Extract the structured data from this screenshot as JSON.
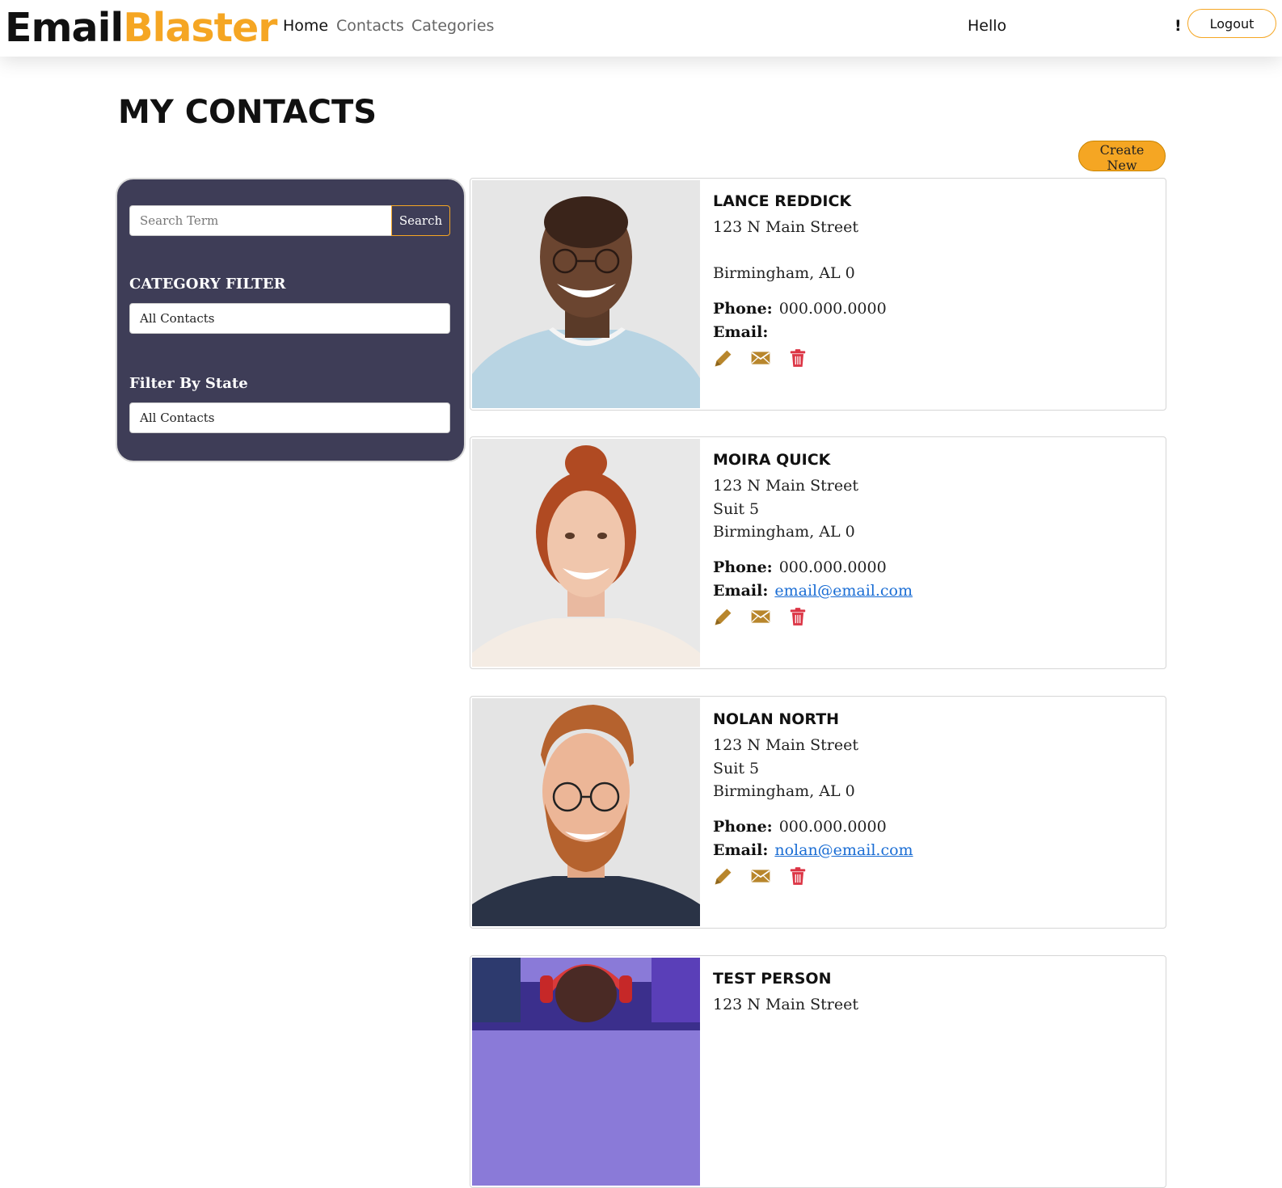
{
  "nav": {
    "logo_part1": "Email",
    "logo_part2": "Blaster",
    "links": [
      "Home",
      "Contacts",
      "Categories"
    ],
    "greeting": "Hello",
    "greeting_suffix": "!",
    "logout_label": "Logout"
  },
  "page": {
    "title": "MY CONTACTS",
    "create_label": "Create New"
  },
  "sidebar": {
    "search_placeholder": "Search Term",
    "search_label": "Search",
    "category_heading": "CATEGORY FILTER",
    "category_value": "All Contacts",
    "state_heading": "Filter By State",
    "state_value": "All Contacts"
  },
  "contacts": [
    {
      "name": "LANCE REDDICK",
      "address1": "123 N Main Street",
      "address2": "",
      "city": "Birmingham, AL 0",
      "phone_label": "Phone:",
      "phone": "000.000.0000",
      "email_label": "Email:",
      "email": ""
    },
    {
      "name": "MOIRA QUICK",
      "address1": "123 N Main Street",
      "address2": "Suit 5",
      "city": "Birmingham, AL 0",
      "phone_label": "Phone:",
      "phone": "000.000.0000",
      "email_label": "Email:",
      "email": "email@email.com"
    },
    {
      "name": "NOLAN NORTH",
      "address1": "123 N Main Street",
      "address2": "Suit 5",
      "city": "Birmingham, AL 0",
      "phone_label": "Phone:",
      "phone": "000.000.0000",
      "email_label": "Email:",
      "email": "nolan@email.com"
    },
    {
      "name": "TEST PERSON",
      "address1": "123 N Main Street"
    }
  ],
  "colors": {
    "accent": "#f5a623",
    "sidebar_bg": "#3e3d57",
    "edit_icon": "#b8862c",
    "delete_icon": "#dc3545",
    "link": "#1a6dd4"
  },
  "icons": [
    "pencil-icon",
    "envelope-icon",
    "trash-icon"
  ]
}
